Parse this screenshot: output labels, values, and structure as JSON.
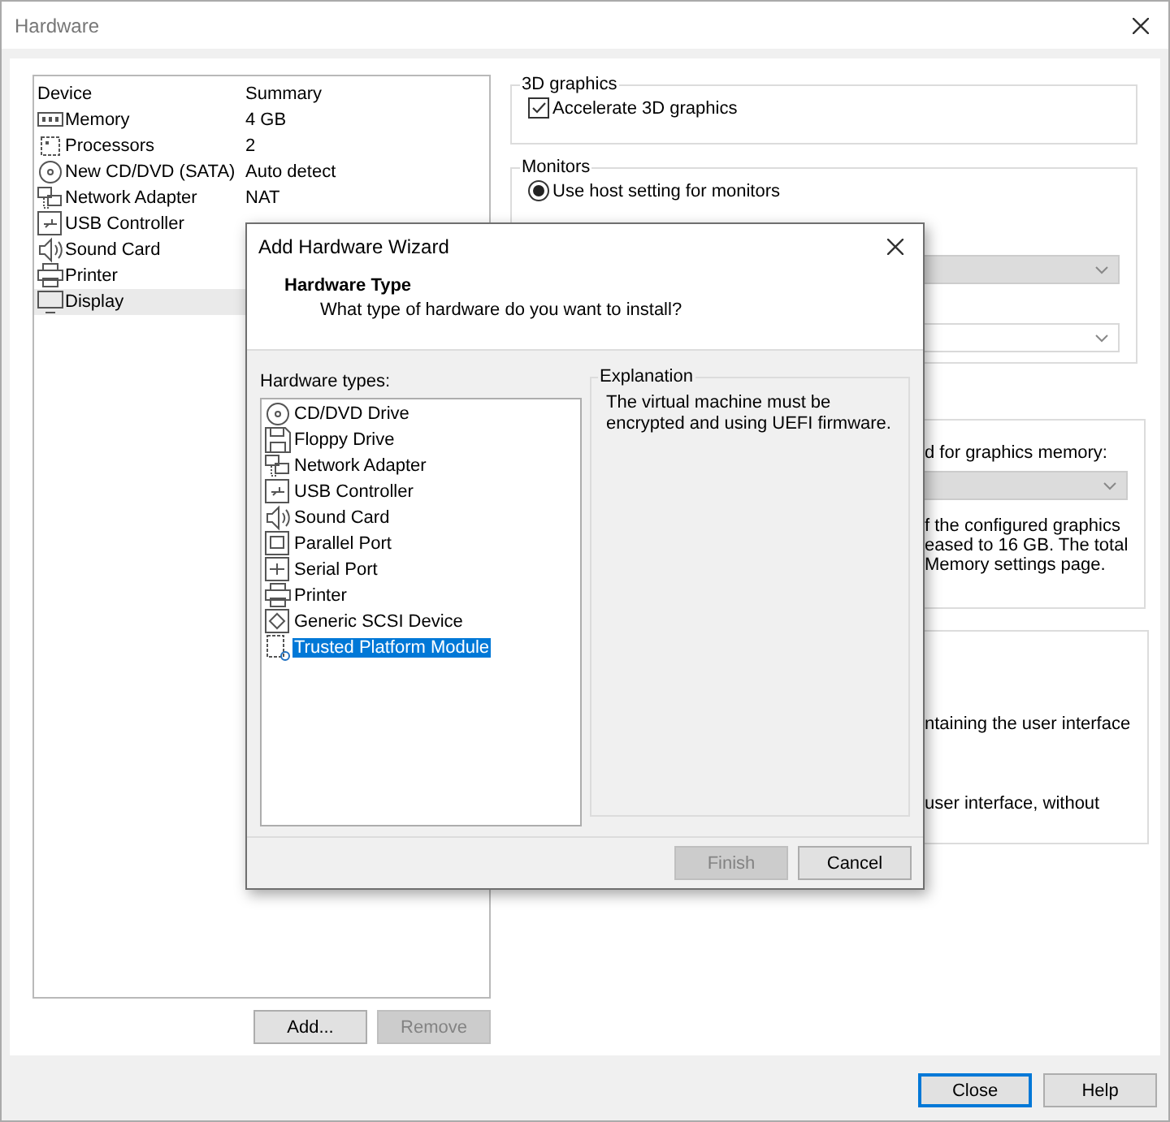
{
  "window": {
    "title": "Hardware"
  },
  "device_list": {
    "columns": [
      "Device",
      "Summary"
    ],
    "rows": [
      {
        "kind": "memory",
        "device": "Memory",
        "summary": "4 GB",
        "selected": false
      },
      {
        "kind": "cpu",
        "device": "Processors",
        "summary": "2",
        "selected": false
      },
      {
        "kind": "cd",
        "device": "New CD/DVD (SATA)",
        "summary": "Auto detect",
        "selected": false
      },
      {
        "kind": "network",
        "device": "Network Adapter",
        "summary": "NAT",
        "selected": false
      },
      {
        "kind": "usb",
        "device": "USB Controller",
        "selected": false
      },
      {
        "kind": "sound",
        "device": "Sound Card",
        "selected": false
      },
      {
        "kind": "printer",
        "device": "Printer",
        "selected": false
      },
      {
        "kind": "display",
        "device": "Display",
        "selected": true
      }
    ]
  },
  "list_buttons": [
    {
      "label": "Add...",
      "disabled": false
    },
    {
      "label": "Remove",
      "disabled": true
    }
  ],
  "graphics_3d": {
    "title": "3D graphics",
    "checkbox": {
      "label": "Accelerate 3D graphics",
      "checked": true
    }
  },
  "monitors": {
    "title": "Monitors",
    "radio": {
      "label": "Use host setting for monitors",
      "selected": true
    },
    "dropdowns": [
      {
        "disabled": true
      },
      {
        "disabled": false
      }
    ]
  },
  "memory_group": {
    "label": "d for graphics memory:",
    "dropdown": {
      "disabled": true
    },
    "note_lines": [
      "f the configured graphics",
      "eased to 16 GB. The total",
      "Memory settings page."
    ]
  },
  "display_group": {
    "lines": [
      "ntaining the user interface",
      "user interface, without"
    ]
  },
  "footer_buttons": [
    {
      "label": "Close",
      "default": true
    },
    {
      "label": "Help",
      "default": false
    }
  ],
  "dialog": {
    "title": "Add Hardware Wizard",
    "heading": "Hardware Type",
    "subtitle": "What type of hardware do you want to install?",
    "types_label": "Hardware types:",
    "hardware_types": [
      {
        "kind": "cd",
        "label": "CD/DVD Drive",
        "selected": false
      },
      {
        "kind": "floppy",
        "label": "Floppy Drive",
        "selected": false
      },
      {
        "kind": "network",
        "label": "Network Adapter",
        "selected": false
      },
      {
        "kind": "usb",
        "label": "USB Controller",
        "selected": false
      },
      {
        "kind": "sound",
        "label": "Sound Card",
        "selected": false
      },
      {
        "kind": "parallel",
        "label": "Parallel Port",
        "selected": false
      },
      {
        "kind": "serial",
        "label": "Serial Port",
        "selected": false
      },
      {
        "kind": "printer",
        "label": "Printer",
        "selected": false
      },
      {
        "kind": "scsi",
        "label": "Generic SCSI Device",
        "selected": false
      },
      {
        "kind": "tpm",
        "label": "Trusted Platform Module",
        "selected": true
      }
    ],
    "explanation": {
      "title": "Explanation",
      "text": "The virtual machine must be encrypted and using UEFI firmware."
    },
    "buttons": [
      {
        "label": "Finish",
        "disabled": true
      },
      {
        "label": "Cancel",
        "disabled": false
      }
    ]
  }
}
